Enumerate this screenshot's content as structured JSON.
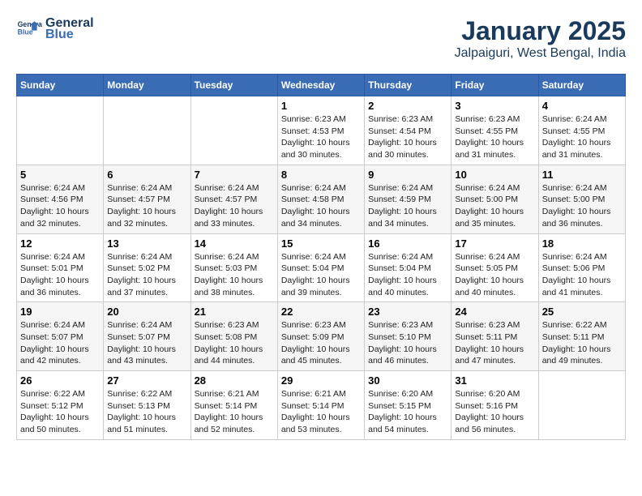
{
  "header": {
    "logo_line1": "General",
    "logo_line2": "Blue",
    "month": "January 2025",
    "location": "Jalpaiguri, West Bengal, India"
  },
  "days_of_week": [
    "Sunday",
    "Monday",
    "Tuesday",
    "Wednesday",
    "Thursday",
    "Friday",
    "Saturday"
  ],
  "weeks": [
    [
      {
        "day": "",
        "info": ""
      },
      {
        "day": "",
        "info": ""
      },
      {
        "day": "",
        "info": ""
      },
      {
        "day": "1",
        "info": "Sunrise: 6:23 AM\nSunset: 4:53 PM\nDaylight: 10 hours and 30 minutes."
      },
      {
        "day": "2",
        "info": "Sunrise: 6:23 AM\nSunset: 4:54 PM\nDaylight: 10 hours and 30 minutes."
      },
      {
        "day": "3",
        "info": "Sunrise: 6:23 AM\nSunset: 4:55 PM\nDaylight: 10 hours and 31 minutes."
      },
      {
        "day": "4",
        "info": "Sunrise: 6:24 AM\nSunset: 4:55 PM\nDaylight: 10 hours and 31 minutes."
      }
    ],
    [
      {
        "day": "5",
        "info": "Sunrise: 6:24 AM\nSunset: 4:56 PM\nDaylight: 10 hours and 32 minutes."
      },
      {
        "day": "6",
        "info": "Sunrise: 6:24 AM\nSunset: 4:57 PM\nDaylight: 10 hours and 32 minutes."
      },
      {
        "day": "7",
        "info": "Sunrise: 6:24 AM\nSunset: 4:57 PM\nDaylight: 10 hours and 33 minutes."
      },
      {
        "day": "8",
        "info": "Sunrise: 6:24 AM\nSunset: 4:58 PM\nDaylight: 10 hours and 34 minutes."
      },
      {
        "day": "9",
        "info": "Sunrise: 6:24 AM\nSunset: 4:59 PM\nDaylight: 10 hours and 34 minutes."
      },
      {
        "day": "10",
        "info": "Sunrise: 6:24 AM\nSunset: 5:00 PM\nDaylight: 10 hours and 35 minutes."
      },
      {
        "day": "11",
        "info": "Sunrise: 6:24 AM\nSunset: 5:00 PM\nDaylight: 10 hours and 36 minutes."
      }
    ],
    [
      {
        "day": "12",
        "info": "Sunrise: 6:24 AM\nSunset: 5:01 PM\nDaylight: 10 hours and 36 minutes."
      },
      {
        "day": "13",
        "info": "Sunrise: 6:24 AM\nSunset: 5:02 PM\nDaylight: 10 hours and 37 minutes."
      },
      {
        "day": "14",
        "info": "Sunrise: 6:24 AM\nSunset: 5:03 PM\nDaylight: 10 hours and 38 minutes."
      },
      {
        "day": "15",
        "info": "Sunrise: 6:24 AM\nSunset: 5:04 PM\nDaylight: 10 hours and 39 minutes."
      },
      {
        "day": "16",
        "info": "Sunrise: 6:24 AM\nSunset: 5:04 PM\nDaylight: 10 hours and 40 minutes."
      },
      {
        "day": "17",
        "info": "Sunrise: 6:24 AM\nSunset: 5:05 PM\nDaylight: 10 hours and 40 minutes."
      },
      {
        "day": "18",
        "info": "Sunrise: 6:24 AM\nSunset: 5:06 PM\nDaylight: 10 hours and 41 minutes."
      }
    ],
    [
      {
        "day": "19",
        "info": "Sunrise: 6:24 AM\nSunset: 5:07 PM\nDaylight: 10 hours and 42 minutes."
      },
      {
        "day": "20",
        "info": "Sunrise: 6:24 AM\nSunset: 5:07 PM\nDaylight: 10 hours and 43 minutes."
      },
      {
        "day": "21",
        "info": "Sunrise: 6:23 AM\nSunset: 5:08 PM\nDaylight: 10 hours and 44 minutes."
      },
      {
        "day": "22",
        "info": "Sunrise: 6:23 AM\nSunset: 5:09 PM\nDaylight: 10 hours and 45 minutes."
      },
      {
        "day": "23",
        "info": "Sunrise: 6:23 AM\nSunset: 5:10 PM\nDaylight: 10 hours and 46 minutes."
      },
      {
        "day": "24",
        "info": "Sunrise: 6:23 AM\nSunset: 5:11 PM\nDaylight: 10 hours and 47 minutes."
      },
      {
        "day": "25",
        "info": "Sunrise: 6:22 AM\nSunset: 5:11 PM\nDaylight: 10 hours and 49 minutes."
      }
    ],
    [
      {
        "day": "26",
        "info": "Sunrise: 6:22 AM\nSunset: 5:12 PM\nDaylight: 10 hours and 50 minutes."
      },
      {
        "day": "27",
        "info": "Sunrise: 6:22 AM\nSunset: 5:13 PM\nDaylight: 10 hours and 51 minutes."
      },
      {
        "day": "28",
        "info": "Sunrise: 6:21 AM\nSunset: 5:14 PM\nDaylight: 10 hours and 52 minutes."
      },
      {
        "day": "29",
        "info": "Sunrise: 6:21 AM\nSunset: 5:14 PM\nDaylight: 10 hours and 53 minutes."
      },
      {
        "day": "30",
        "info": "Sunrise: 6:20 AM\nSunset: 5:15 PM\nDaylight: 10 hours and 54 minutes."
      },
      {
        "day": "31",
        "info": "Sunrise: 6:20 AM\nSunset: 5:16 PM\nDaylight: 10 hours and 56 minutes."
      },
      {
        "day": "",
        "info": ""
      }
    ]
  ]
}
